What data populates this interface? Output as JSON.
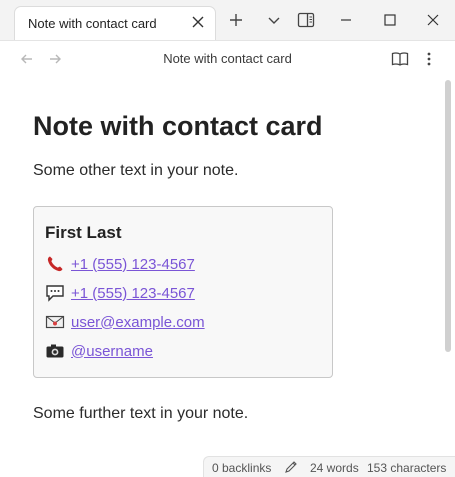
{
  "window": {
    "tab_title": "Note with contact card"
  },
  "navbar": {
    "title": "Note with contact card"
  },
  "note": {
    "title": "Note with contact card",
    "intro": "Some other text in your note.",
    "outro": "Some further text in your note."
  },
  "contact_card": {
    "name": "First Last",
    "phone": "+1 (555) 123-4567",
    "sms": "+1 (555) 123-4567",
    "email": "user@example.com",
    "social": "@username",
    "link_color": "#7a55d6"
  },
  "status": {
    "backlinks": "0 backlinks",
    "words": "24 words",
    "characters": "153 characters"
  }
}
